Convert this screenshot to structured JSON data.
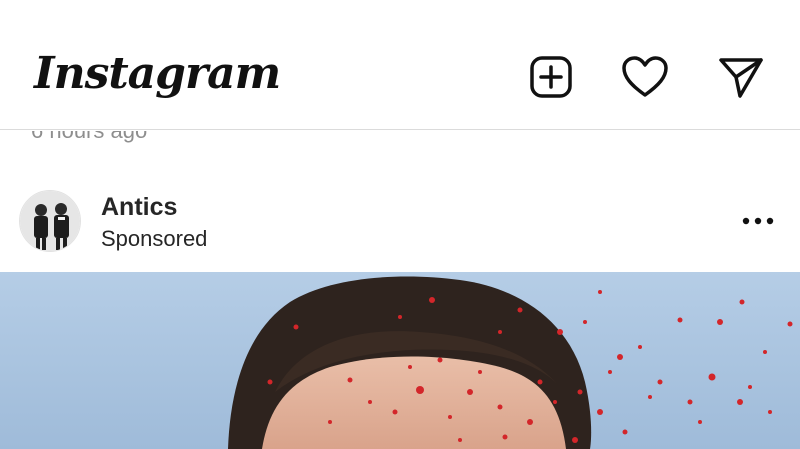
{
  "header": {
    "logo_text": "Instagram",
    "icons": {
      "new_post": "plus-square-icon",
      "activity": "heart-icon",
      "direct": "paper-plane-icon"
    }
  },
  "previous_post": {
    "time_ago": "6 hours ago"
  },
  "post": {
    "username": "Antics",
    "label": "Sponsored",
    "more_icon": "more-horizontal-icon",
    "media_description_colors": {
      "sky": "#a9c3df",
      "hair": "#2e231e",
      "skin": "#e2b19b",
      "splatter": "#d3262a"
    }
  },
  "colors": {
    "text_primary": "#262626",
    "text_secondary": "#8e8e8e",
    "divider": "#dbdbdb",
    "background": "#ffffff"
  }
}
